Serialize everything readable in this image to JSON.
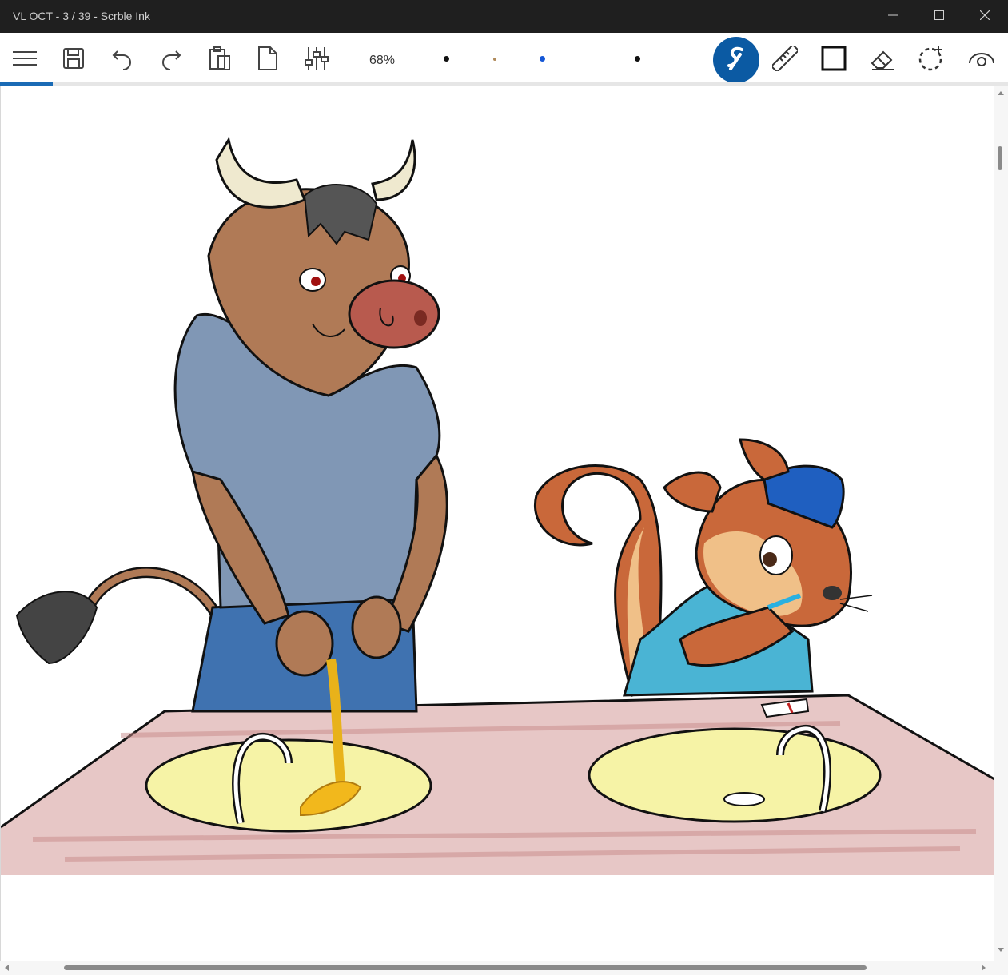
{
  "window": {
    "title": "VL OCT - 3 / 39 - Scrble Ink",
    "minimize_icon": "minimize-icon",
    "maximize_icon": "maximize-icon",
    "close_icon": "close-icon"
  },
  "toolbar": {
    "zoom": "68%",
    "tools": [
      "menu-icon",
      "save-icon",
      "undo-icon",
      "redo-icon",
      "paste-icon",
      "new-page-icon",
      "settings-sliders-icon"
    ],
    "pens": [
      {
        "color": "#111111",
        "size": "small"
      },
      {
        "color": "#b08a5a",
        "size": "tiny"
      },
      {
        "color": "#1557d6",
        "size": "small"
      },
      {
        "color": "#111111",
        "size": "small"
      }
    ],
    "right_tools": [
      "scrble-pen-icon",
      "ruler-icon",
      "shape-icon",
      "eraser-icon",
      "lasso-select-icon",
      "view-icon"
    ],
    "accent": "#0b5aa3"
  },
  "progress": {
    "page": 3,
    "total": 39,
    "fraction": 0.0769
  },
  "scroll": {
    "vertical_fraction": 0.05,
    "horizontal_visible_fraction": 0.83
  }
}
